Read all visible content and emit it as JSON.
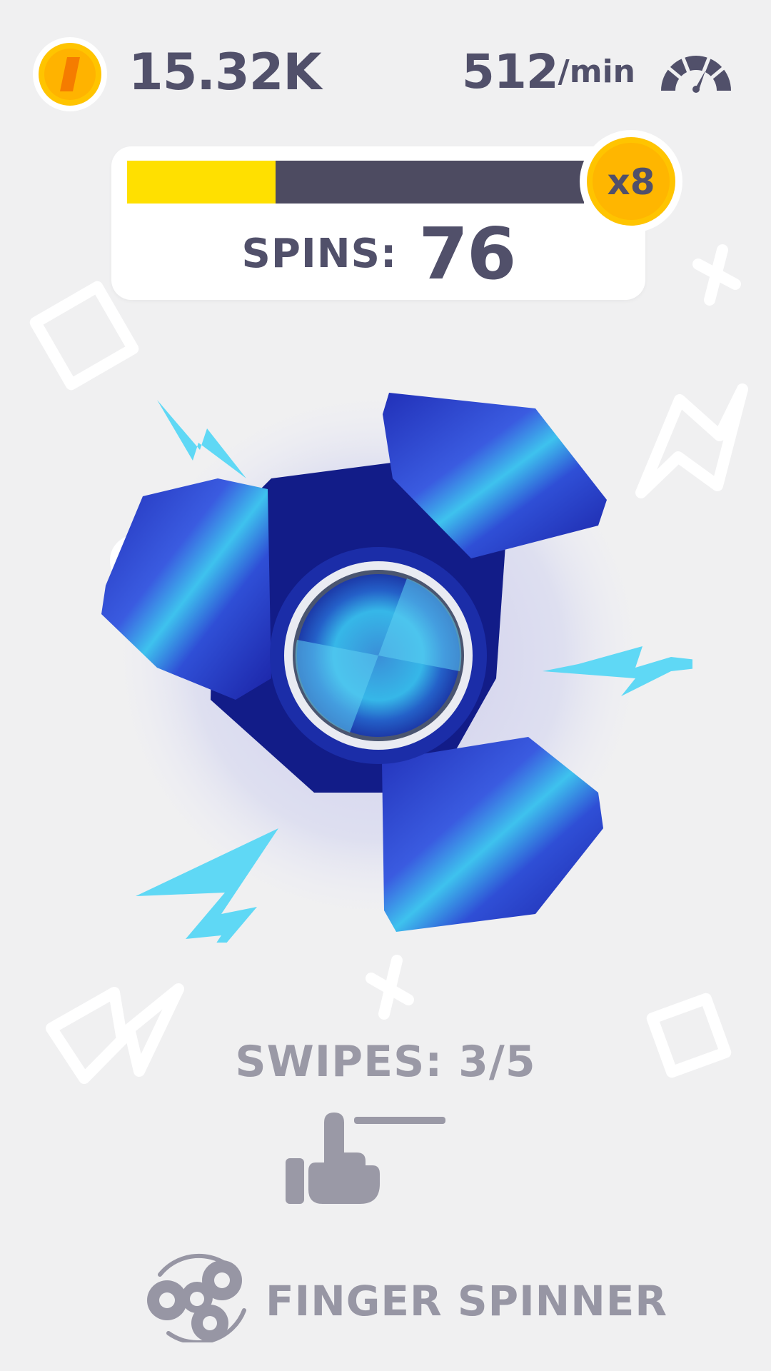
{
  "hud": {
    "coins": "15.32K",
    "speed_value": "512",
    "speed_unit": "/min",
    "icons": {
      "coin": "coin-icon",
      "speed": "speedometer-icon"
    }
  },
  "progress": {
    "fraction": 0.325,
    "multiplier": "x8",
    "spins_label": "SPINS:",
    "spins_value": "76"
  },
  "swipes": {
    "text": "SWIPES: 3/5",
    "icon": "swipe-hand-icon"
  },
  "brand": {
    "title": "FINGER SPINNER",
    "icon": "fidget-spinner-logo"
  },
  "colors": {
    "background": "#f0f0f1",
    "text_dark": "#51506a",
    "text_muted": "#9a99a6",
    "progress_fill": "#ffe000",
    "progress_track": "#4d4b61",
    "coin_gold": "#ffbf00",
    "spinner_blue": "#2a36b8",
    "spark_cyan": "#5fd8f5"
  }
}
